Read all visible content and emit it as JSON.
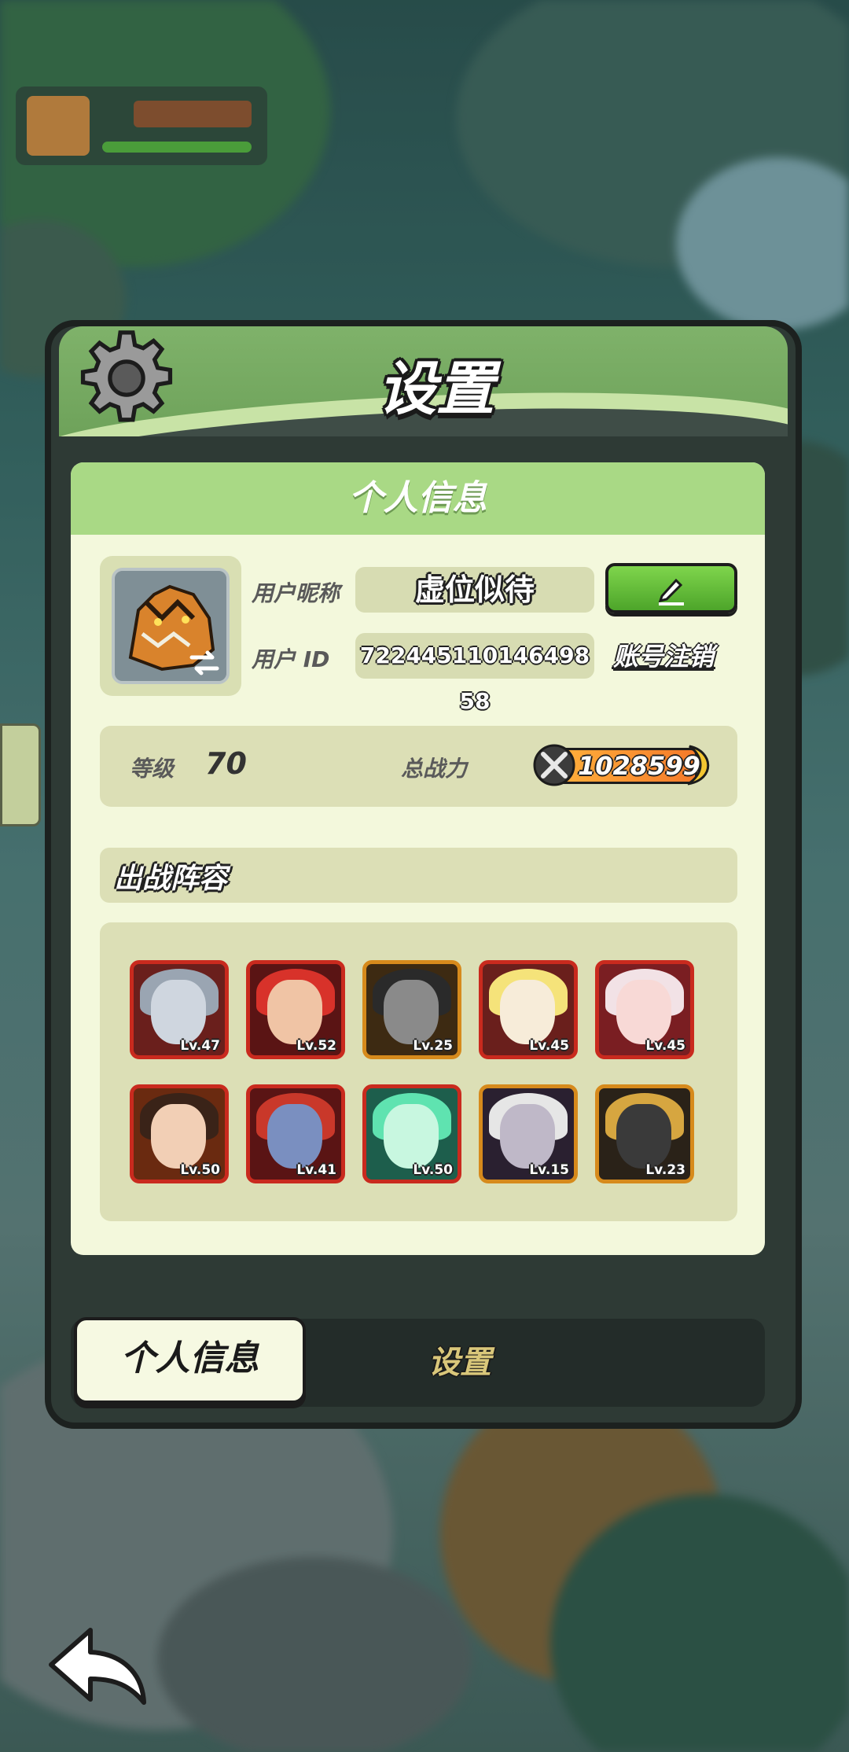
{
  "dialog": {
    "title": "设置",
    "panel_title": "个人信息"
  },
  "profile": {
    "nickname_label": "用户昵称",
    "nickname": "虚位似待",
    "id_label": "用户 ID",
    "user_id": "722445110146498 58",
    "logout_label": "账号注销"
  },
  "stats": {
    "level_label": "等级",
    "level": "70",
    "power_label": "总战力",
    "power": "1028599"
  },
  "lineup": {
    "title": "出战阵容",
    "heroes": [
      {
        "level": "Lv.47",
        "frame": "red",
        "bg": "#6a1f1c",
        "hair": "#9aa5b2",
        "face": "#cfd6df"
      },
      {
        "level": "Lv.52",
        "frame": "red",
        "bg": "#5a1414",
        "hair": "#d8322a",
        "face": "#f0c4a5"
      },
      {
        "level": "Lv.25",
        "frame": "gold",
        "bg": "#3d2a12",
        "hair": "#2a2a2a",
        "face": "#8a8a8a"
      },
      {
        "level": "Lv.45",
        "frame": "red",
        "bg": "#6a1f1c",
        "hair": "#f5e37a",
        "face": "#f7ecd9"
      },
      {
        "level": "Lv.45",
        "frame": "red",
        "bg": "#7a1e22",
        "hair": "#f2e2e6",
        "face": "#f8d9d6"
      },
      {
        "level": "Lv.50",
        "frame": "red",
        "bg": "#6a2a10",
        "hair": "#3a2318",
        "face": "#f2cfb5"
      },
      {
        "level": "Lv.41",
        "frame": "red",
        "bg": "#5a1414",
        "hair": "#c9382a",
        "face": "#7a8fc0"
      },
      {
        "level": "Lv.50",
        "frame": "red",
        "bg": "#1d5e4c",
        "hair": "#5fe3b0",
        "face": "#c8f7e0"
      },
      {
        "level": "Lv.15",
        "frame": "gold",
        "bg": "#2a2030",
        "hair": "#e6e6e6",
        "face": "#bfb8c8"
      },
      {
        "level": "Lv.23",
        "frame": "gold",
        "bg": "#2a2218",
        "hair": "#d6a640",
        "face": "#3a3a3a"
      }
    ]
  },
  "tabs": {
    "active": "个人信息",
    "inactive": "设置"
  }
}
